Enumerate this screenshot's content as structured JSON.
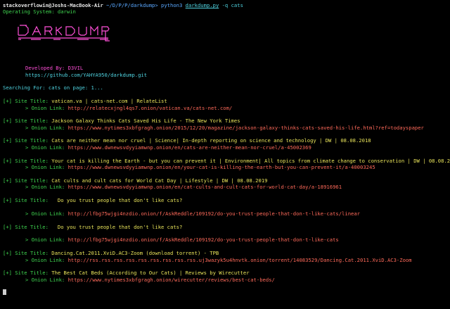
{
  "prompt": {
    "host": "stackoverflowin@Joshs-MacBook-Air",
    "path": "~/D/P/P/darkdump>",
    "cmd": "python3",
    "script": "darkdump.py",
    "args": "-q cats"
  },
  "os_line": "Operating System: darwin",
  "developed_by_label": "Developed By:",
  "developer": "D3VIL",
  "github_url": "https://github.com/YAHYA950/darkdump.git",
  "search_line": "Searching For: cats on page: 1...",
  "site_title_label": "[+] Site Title:",
  "onion_link_label": "> Onion Link:",
  "results": [
    {
      "title": "vatican.va | cats-net.com | RelateList",
      "link": "http://relatecxjngl4qs7.onion/vatican.va/cats-net.com/"
    },
    {
      "title": "Jackson Galaxy Thinks Cats Saved His Life - The New York Times",
      "link": "https://www.nytimes3xbfgragh.onion/2015/12/20/magazine/jackson-galaxy-thinks-cats-saved-his-life.html?ref=todayspaper"
    },
    {
      "title": "Cats are neither mean nor cruel | Science| In-depth reporting on science and technology | DW | 08.08.2018",
      "link": "https://www.dwnewsvdyyiamwnp.onion/en/cats-are-neither-mean-nor-cruel/a-45002369"
    },
    {
      "title": "Your cat is killing the Earth - but you can prevent it | Environment| All topics from climate change to conservation | DW | 08.08.2017",
      "link": "https://www.dwnewsvdyyiamwnp.onion/en/your-cat-is-killing-the-earth-but-you-can-prevent-it/a-40003245"
    },
    {
      "title": "Cat cults and cult cats for World Cat Day | Lifestyle | DW | 08.08.2019",
      "link": "https://www.dwnewsvdyyiamwnp.onion/en/cat-cults-and-cult-cats-for-world-cat-day/a-18916961"
    },
    {
      "title": "  Do you trust people that don't like cats?",
      "link": "http://lfbg75wjgi4nzdio.onion/f/AskReddle/109192/do-you-trust-people-that-don-t-like-cats/linear",
      "spaced": true
    },
    {
      "title": "  Do you trust people that don't like cats?",
      "link": "http://lfbg75wjgi4nzdio.onion/f/AskReddle/109192/do-you-trust-people-that-don-t-like-cats",
      "spaced": true
    },
    {
      "title": "Dancing.Cat.2011.XviD.AC3-Zoom (download torrent) - TPB",
      "link": "http://rss.rss.rss.rss.rss.rss.rss.rss.rss.uj3wazyk5u4hnvtk.onion/torrent/14083529/Dancing.Cat.2011.XviD.AC3-Zoom"
    },
    {
      "title": "The Best Cat Beds (According to Our Cats) | Reviews by Wirecutter",
      "link": "https://www.nytimes3xbfgragh.onion/wirecutter/reviews/best-cat-beds/"
    }
  ],
  "colors": {
    "banner": "#ff4fd8",
    "green": "#3fd34f",
    "link": "#ff6a5a"
  }
}
